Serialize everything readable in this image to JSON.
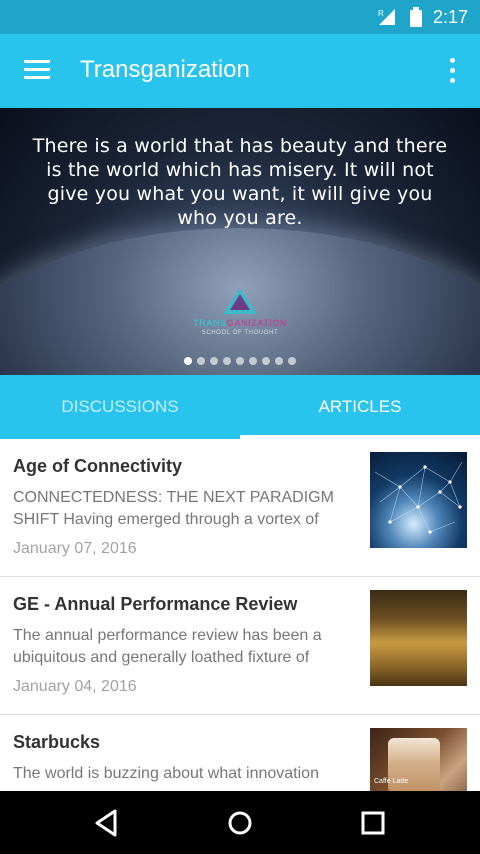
{
  "status_bar": {
    "time": "2:17",
    "icons": [
      "signal-icon",
      "battery-icon"
    ]
  },
  "app_bar": {
    "title": "Transganization",
    "menu_icon": "hamburger-icon",
    "overflow_icon": "more-vert-icon"
  },
  "banner": {
    "quote": "There is a world that has beauty and there is the world which has misery. It will not give you what you want, it will give you who you are.",
    "logo_name_a": "TRANS",
    "logo_name_b": "GANIZATION",
    "logo_sub": "SCHOOL OF THOUGHT",
    "slides_total": 9,
    "active_slide": 1
  },
  "tabs": [
    {
      "label": "DISCUSSIONS",
      "active": false
    },
    {
      "label": "ARTICLES",
      "active": true
    }
  ],
  "articles": [
    {
      "title": "Age of Connectivity",
      "excerpt": "CONNECTEDNESS: THE NEXT PARADIGM SHIFT Having emerged through a vortex of",
      "date": "January 07, 2016",
      "thumb": "network-globe-image"
    },
    {
      "title": "GE - Annual Performance Review",
      "excerpt": "The annual performance review has been a ubiquitous and generally loathed fixture of",
      "date": "January 04, 2016",
      "thumb": "office-interior-image"
    },
    {
      "title": "Starbucks",
      "excerpt": "The world is buzzing about what innovation",
      "date": "",
      "thumb": "coffee-image",
      "thumb_caption": "Caffe Latte"
    }
  ],
  "colors": {
    "status_bar": "#1ea5c9",
    "primary": "#29c4ee",
    "title_text": "#333333",
    "excerpt_text": "#777777",
    "date_text": "#a3a3a3"
  }
}
